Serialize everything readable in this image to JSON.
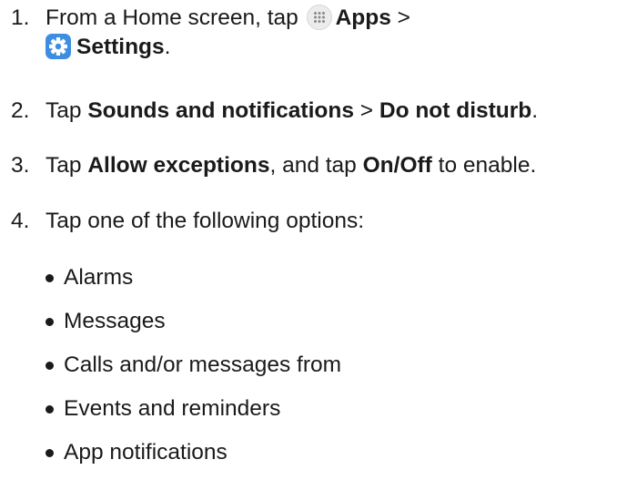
{
  "steps": [
    {
      "number": "1.",
      "parts": [
        "From a Home screen, tap",
        "Apps",
        ">",
        "Settings",
        "."
      ],
      "icons": [
        "apps-grid-icon",
        "settings-gear-icon"
      ]
    },
    {
      "number": "2.",
      "parts": [
        "Tap ",
        "Sounds and notifications",
        " > ",
        "Do not disturb",
        "."
      ]
    },
    {
      "number": "3.",
      "parts": [
        "Tap ",
        "Allow exceptions",
        ", and tap ",
        "On/Off",
        " to enable."
      ]
    },
    {
      "number": "4.",
      "parts": [
        "Tap one of the following options:"
      ]
    }
  ],
  "options": [
    "Alarms",
    "Messages",
    "Calls and/or messages from",
    "Events and reminders",
    "App notifications"
  ],
  "colors": {
    "text": "#1a1a1a",
    "settings_icon_bg": "#3d8de0",
    "apps_icon_bg": "#ececec"
  }
}
